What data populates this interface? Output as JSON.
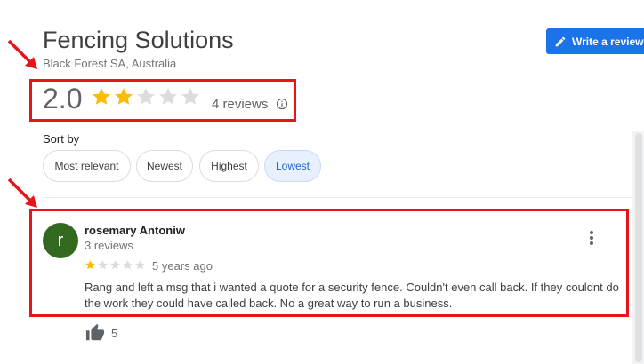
{
  "business": {
    "name": "Fencing Solutions",
    "location": "Black Forest SA, Australia"
  },
  "actions": {
    "write_review_label": "Write a review"
  },
  "summary": {
    "rating": "2.0",
    "stars_filled": 2,
    "stars_total": 5,
    "review_count_label": "4 reviews"
  },
  "sort": {
    "label": "Sort by",
    "options": [
      "Most relevant",
      "Newest",
      "Highest",
      "Lowest"
    ],
    "selected": "Lowest"
  },
  "reviews": [
    {
      "avatar_letter": "r",
      "avatar_color": "#33691e",
      "author": "rosemary Antoniw",
      "author_review_count": "3 reviews",
      "stars": 1,
      "age": "5 years ago",
      "text": "Rang and left a msg that i wanted a quote for a security fence. Couldn't even call back. If they couldnt do the work they could have called back. No a great way to run a business.",
      "likes": "5"
    }
  ],
  "colors": {
    "accent": "#1a73e8",
    "star_filled": "#fbbc04",
    "star_empty": "#dadce0",
    "annotation_red": "#e8141b",
    "selected_chip_bg": "#e8f0fe"
  },
  "icons": [
    "pencil-icon",
    "star-icon",
    "info-icon",
    "more-vert-icon",
    "thumb-up-icon",
    "annotation-arrow-icon"
  ]
}
